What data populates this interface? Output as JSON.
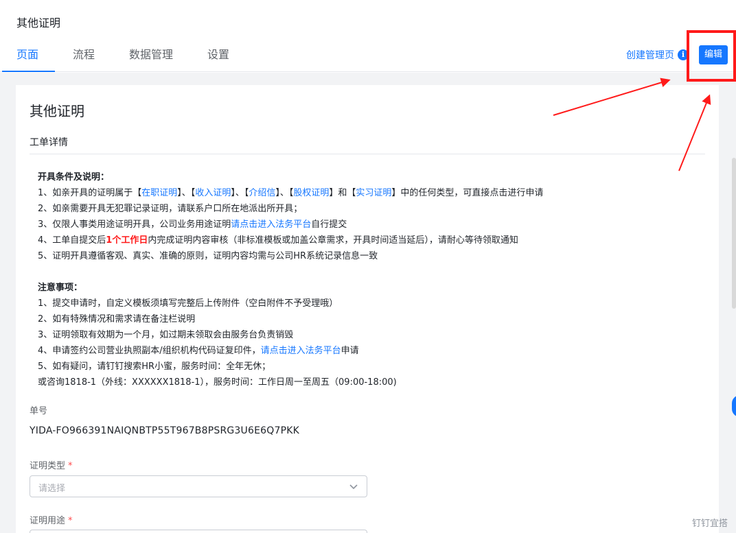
{
  "app": {
    "title": "其他证明"
  },
  "tabs": [
    {
      "label": "页面"
    },
    {
      "label": "流程"
    },
    {
      "label": "数据管理"
    },
    {
      "label": "设置"
    }
  ],
  "header_actions": {
    "create_link": "创建管理页",
    "info_icon_glyph": "i",
    "edit_label": "编辑"
  },
  "form": {
    "title": "其他证明",
    "section": "工单详情",
    "conditions": {
      "heading": "开具条件及说明：",
      "line1_a": "1、如亲开具的证明属于【",
      "line1_link1": "在职证明",
      "line1_b": "】、【",
      "line1_link2": "收入证明",
      "line1_c": "】、【",
      "line1_link3": "介绍信",
      "line1_d": "】、【",
      "line1_link4": "股权证明",
      "line1_e": "】和【",
      "line1_link5": "实习证明",
      "line1_f": "】中的任何类型，可直接点击进行申请",
      "line2": "2、如亲需要开具无犯罪记录证明，请联系户口所在地派出所开具；",
      "line3_a": "3、仅限人事类用途证明开具，公司业务用途证明",
      "line3_link": "请点击进入法务平台",
      "line3_b": "自行提交",
      "line4_a": "4、工单自提交后",
      "line4_red": "1个工作日",
      "line4_b": "内完成证明内容审核（非标准模板或加盖公章需求，开具时间适当延后），请耐心等待领取通知",
      "line5": "5、证明开具遵循客观、真实、准确的原则，证明内容均需与公司HR系统记录信息一致"
    },
    "notes": {
      "heading": "注意事项：",
      "line1": "1、提交申请时，自定义模板须填写完整后上传附件（空白附件不予受理哦）",
      "line2": "2、如有特殊情况和需求请在备注栏说明",
      "line3": "3、证明领取有效期为一个月，如过期未领取会由服务台负责销毁",
      "line4_a": "4、申请签约公司营业执照副本/组织机构代码证复印件，",
      "line4_link": "请点击进入法务平台",
      "line4_b": "申请",
      "line5": "5、如有疑问，请钉钉搜索HR小蜜，服务时间：全年无休；",
      "line6": "或咨询1818-1（外线：XXXXXX1818-1），服务时间：工作日周一至周五（09:00-18:00)"
    },
    "order_no": {
      "label": "单号",
      "value": "YIDA-FO966391NAIQNBTP55T967B8PSRG3U6E6Q7PKK"
    },
    "cert_type": {
      "label": "证明类型",
      "required": "*",
      "placeholder": "请选择"
    },
    "cert_usage": {
      "label": "证明用途",
      "required": "*"
    }
  },
  "watermark": "钉钉宜搭",
  "colors": {
    "accent": "#1677ff",
    "highlight": "#ff1a1a",
    "canvas": "#f2f3f5"
  },
  "icons": [
    "info-icon",
    "chevron-down-icon"
  ]
}
